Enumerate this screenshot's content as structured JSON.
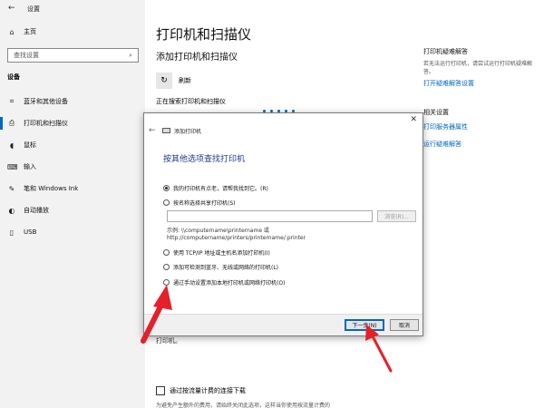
{
  "window": {
    "title": "设置",
    "back_glyph": "←"
  },
  "sidebar": {
    "home_label": "主页",
    "search_placeholder": "查找设置",
    "section_label": "设备",
    "items": [
      {
        "label": "蓝牙和其他设备",
        "icon": "bluetooth-icon",
        "glyph": "⌗",
        "active": false
      },
      {
        "label": "打印机和扫描仪",
        "icon": "printer-icon",
        "glyph": "⎙",
        "active": true
      },
      {
        "label": "鼠标",
        "icon": "mouse-icon",
        "glyph": "◖",
        "active": false
      },
      {
        "label": "输入",
        "icon": "keyboard-icon",
        "glyph": "⌨",
        "active": false
      },
      {
        "label": "笔和 Windows Ink",
        "icon": "pen-icon",
        "glyph": "✎",
        "active": false
      },
      {
        "label": "自动播放",
        "icon": "autoplay-icon",
        "glyph": "◐",
        "active": false
      },
      {
        "label": "USB",
        "icon": "usb-icon",
        "glyph": "▯",
        "active": false
      }
    ]
  },
  "main": {
    "title": "打印机和扫描仪",
    "subtitle": "添加打印机和扫描仪",
    "refresh_label": "刷新",
    "searching_text": "正在搜索打印机和扫描仪",
    "printer_suffix": "打印机。",
    "metered_label": "通过按流量计费的连接下载",
    "metered_desc": "为避免产生额外的费用，请始终关闭此选项，这样当你使用按流量计费的"
  },
  "right_panel": {
    "troubleshoot_heading": "打印机疑难解答",
    "troubleshoot_desc": "若无法运行打印机，请尝试运行打印机疑难解答。",
    "troubleshoot_link": "打开疑难解答设置",
    "related_heading": "相关设置",
    "server_props_link": "打印服务器属性",
    "run_troubleshooter_link": "运行疑难解答"
  },
  "dialog": {
    "close_glyph": "✕",
    "title": "添加打印机",
    "heading": "按其他选项查找打印机",
    "options": [
      {
        "label": "我的打印机有点老，请帮我找到它。(R)",
        "checked": true
      },
      {
        "label": "按名称选择共享打印机(S)",
        "checked": false
      },
      {
        "label": "使用 TCP/IP 地址或主机名添加打印机(I)",
        "checked": false
      },
      {
        "label": "添加可检测到蓝牙、无线或网络的打印机(L)",
        "checked": false
      },
      {
        "label": "通过手动设置添加本地打印机或网络打印机(O)",
        "checked": false
      }
    ],
    "share_input_value": "",
    "browse_label": "浏览(R)...",
    "example_line1": "示例: \\\\computername\\printername 或",
    "example_line2": "http://computername/printers/printername/.printer",
    "next_label": "下一步(N)",
    "cancel_label": "取消"
  },
  "colors": {
    "accent": "#0067c0",
    "annotation_arrow": "#e5202a"
  }
}
